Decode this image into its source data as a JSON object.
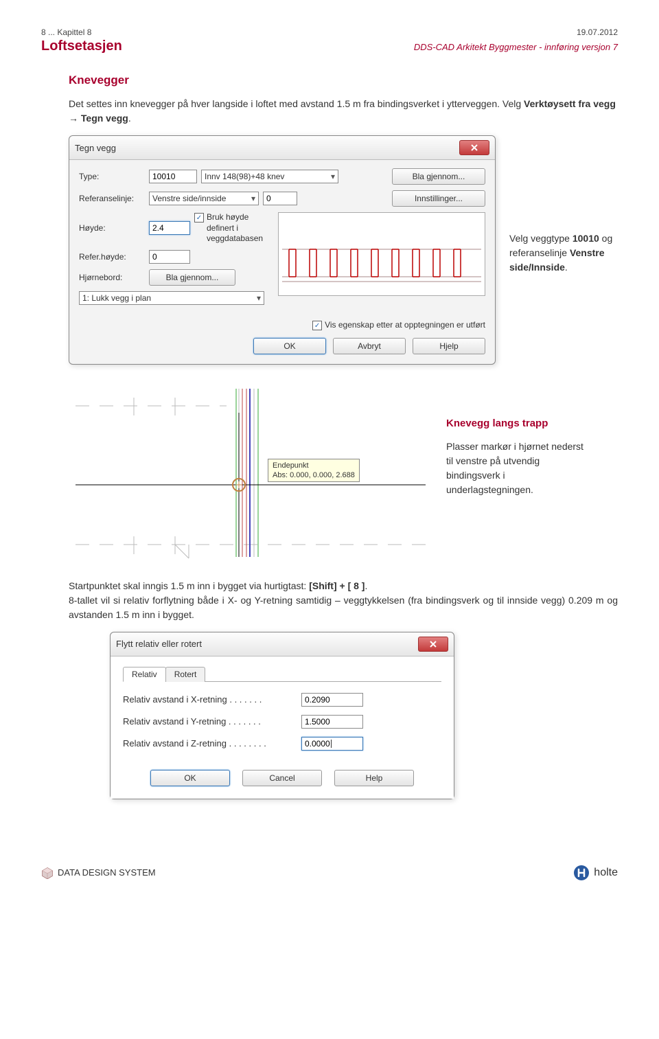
{
  "header": {
    "chapter": "8 ... Kapittel 8",
    "date": "19.07.2012",
    "title": "Loftsetasjen",
    "subtitle": "DDS-CAD Arkitekt Byggmester -  innføring versjon 7"
  },
  "section": {
    "title": "Knevegger",
    "para1_a": "Det settes inn knevegger på hver langside i loftet med avstand 1.5 m fra bindingsverket i  ytterveggen. Velg ",
    "para1_b": "Verktøysett fra vegg",
    "para1_c": " → ",
    "para1_d": "Tegn vegg",
    "para1_e": "."
  },
  "dialog1": {
    "title": "Tegn vegg",
    "type_label": "Type:",
    "type_code": "10010",
    "type_desc": "Innv 148(98)+48 knev",
    "bla_gjennom": "Bla gjennom...",
    "ref_label": "Referanselinje:",
    "ref_value": "Venstre side/innside",
    "ref_offset": "0",
    "innstillinger": "Innstillinger...",
    "hoyde_label": "Høyde:",
    "hoyde_value": "2.4",
    "cb_bruk_hoyde": "Bruk høyde definert i veggdatabasen",
    "refhoyde_label": "Refer.høyde:",
    "refhoyde_value": "0",
    "hjorne_label": "Hjørnebord:",
    "hjorne_btn": "Bla gjennom...",
    "lukk_label": "1: Lukk vegg i plan",
    "cb_vis_egenskap": "Vis egenskap etter at opptegningen er utført",
    "ok": "OK",
    "avbryt": "Avbryt",
    "hjelp": "Hjelp"
  },
  "caption1_a": "Velg veggtype ",
  "caption1_b": "10010",
  "caption1_c": " og referanselinje ",
  "caption1_d": "Venstre side/Innside",
  "caption1_e": ".",
  "plan": {
    "tooltip_title": "Endepunkt",
    "tooltip_abs": "Abs: 0.000, 0.000, 2.688",
    "side_title": "Knevegg langs trapp",
    "side_text": "Plasser markør i hjørnet nederst til venstre på utvendig bindingsverk i underlagstegningen."
  },
  "para2": {
    "a": "Startpunktet skal inngis 1.5 m inn i bygget via hurtigtast: ",
    "b": "[Shift] + [ 8 ]",
    "c": ".",
    "d": "8-tallet vil si relativ forflytning både i X- og Y-retning samtidig – veggtykkelsen (fra bindingsverk og til innside vegg) 0.209 m og avstanden 1.5 m inn i bygget."
  },
  "dialog2": {
    "title": "Flytt relativ eller rotert",
    "tab_relativ": "Relativ",
    "tab_rotert": "Rotert",
    "row_x": "Relativ avstand i X-retning . . . . . . .",
    "val_x": "0.2090",
    "row_y": "Relativ avstand i Y-retning . . . . . . .",
    "val_y": "1.5000",
    "row_z": "Relativ avstand i Z-retning . . . . . . . .",
    "val_z": "0.0000",
    "ok": "OK",
    "cancel": "Cancel",
    "help": "Help"
  },
  "footer": {
    "dds_a": "D",
    "dds_b": "ATA ",
    "dds_c": "D",
    "dds_d": "ESIGN ",
    "dds_e": "S",
    "dds_f": "YSTEM",
    "holte": "holte"
  }
}
